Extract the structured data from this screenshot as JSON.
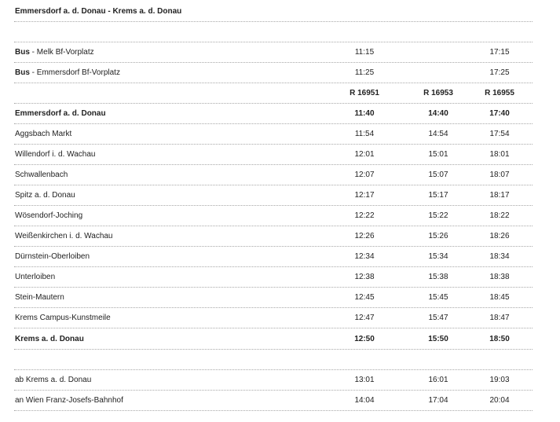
{
  "title": "Emmersdorf a. d. Donau - Krems a. d. Donau",
  "connections": [
    {
      "mode": "Bus",
      "stop": "Melk Bf-Vorplatz",
      "times": [
        "11:15",
        "",
        "17:15"
      ]
    },
    {
      "mode": "Bus",
      "stop": "Emmersdorf Bf-Vorplatz",
      "times": [
        "11:25",
        "",
        "17:25"
      ]
    }
  ],
  "trains": [
    "R 16951",
    "R 16953",
    "R 16955"
  ],
  "stops": [
    {
      "name": "Emmersdorf a. d. Donau",
      "times": [
        "11:40",
        "14:40",
        "17:40"
      ],
      "bold": true
    },
    {
      "name": "Aggsbach Markt",
      "times": [
        "11:54",
        "14:54",
        "17:54"
      ]
    },
    {
      "name": "Willendorf i. d. Wachau",
      "times": [
        "12:01",
        "15:01",
        "18:01"
      ]
    },
    {
      "name": "Schwallenbach",
      "times": [
        "12:07",
        "15:07",
        "18:07"
      ]
    },
    {
      "name": "Spitz a. d. Donau",
      "times": [
        "12:17",
        "15:17",
        "18:17"
      ]
    },
    {
      "name": "Wösendorf-Joching",
      "times": [
        "12:22",
        "15:22",
        "18:22"
      ]
    },
    {
      "name": "Weißenkirchen i. d. Wachau",
      "times": [
        "12:26",
        "15:26",
        "18:26"
      ]
    },
    {
      "name": "Dürnstein-Oberloiben",
      "times": [
        "12:34",
        "15:34",
        "18:34"
      ]
    },
    {
      "name": "Unterloiben",
      "times": [
        "12:38",
        "15:38",
        "18:38"
      ]
    },
    {
      "name": "Stein-Mautern",
      "times": [
        "12:45",
        "15:45",
        "18:45"
      ]
    },
    {
      "name": "Krems Campus-Kunstmeile",
      "times": [
        "12:47",
        "15:47",
        "18:47"
      ]
    },
    {
      "name": "Krems a. d. Donau",
      "times": [
        "12:50",
        "15:50",
        "18:50"
      ],
      "bold": true
    }
  ],
  "onward": [
    {
      "name": "ab Krems a. d. Donau",
      "times": [
        "13:01",
        "16:01",
        "19:03"
      ]
    },
    {
      "name": "an Wien Franz-Josefs-Bahnhof",
      "times": [
        "14:04",
        "17:04",
        "20:04"
      ]
    }
  ]
}
